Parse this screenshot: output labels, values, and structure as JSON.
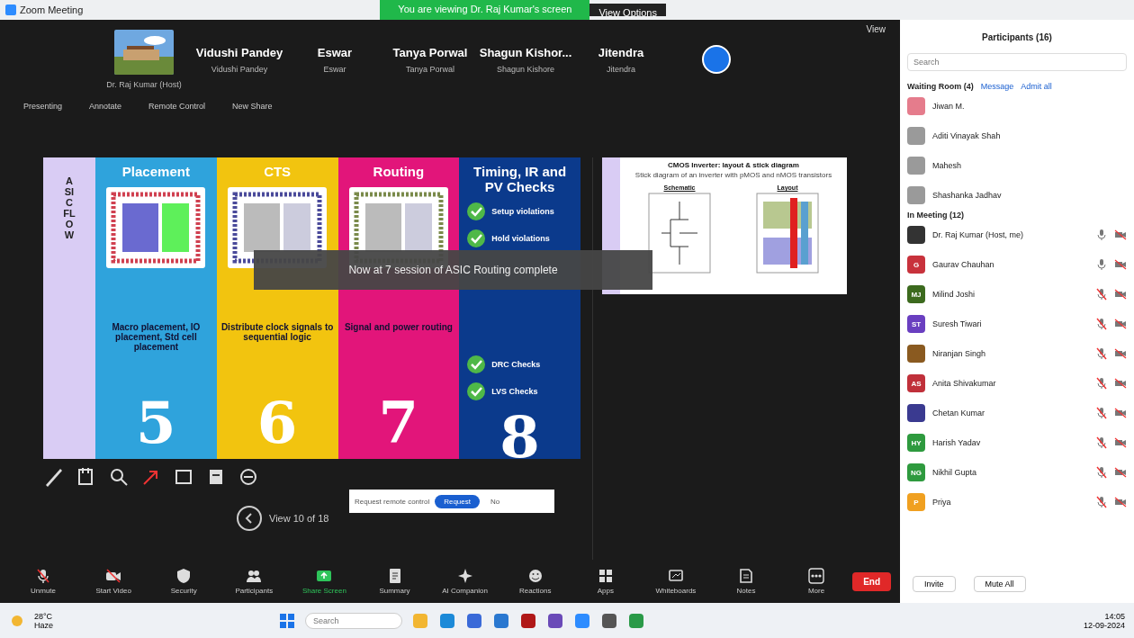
{
  "window": {
    "title": "Zoom Meeting",
    "share_banner": "You are viewing Dr. Raj Kumar's screen",
    "view_options": "View Options"
  },
  "gallery": {
    "tiles": [
      {
        "kind": "picture",
        "caption": "Dr. Raj Kumar (Host)"
      },
      {
        "kind": "name",
        "name": "Vidushi Pandey",
        "caption": "Vidushi Pandey"
      },
      {
        "kind": "name",
        "name": "Eswar",
        "caption": "Eswar"
      },
      {
        "kind": "name",
        "name": "Tanya Porwal",
        "caption": "Tanya Porwal"
      },
      {
        "kind": "name",
        "name": "Shagun Kishor...",
        "caption": "Shagun Kishore"
      },
      {
        "kind": "name",
        "name": "Jitendra",
        "caption": "Jitendra"
      },
      {
        "kind": "avatar"
      }
    ],
    "view": "View"
  },
  "share_bar": {
    "items": [
      "Presenting",
      "Annotate",
      "Remote Control",
      "New Share"
    ]
  },
  "slide_left": {
    "side_title": "ASIC FLOW",
    "columns": [
      {
        "title": "Placement",
        "color": "#2fa3dc",
        "text": "Macro placement, IO placement, Std cell placement",
        "number": "5"
      },
      {
        "title": "CTS",
        "color": "#f2c40f",
        "text": "Distribute clock signals to sequential logic",
        "number": "6"
      },
      {
        "title": "Routing",
        "color": "#e2157a",
        "text": "Signal and power routing",
        "number": "7"
      },
      {
        "title": "Timing, IR and PV Checks",
        "color": "#0b3a8c",
        "checks": [
          "Setup violations",
          "Hold violations",
          "DRC Checks",
          "LVS Checks"
        ],
        "number": "8"
      }
    ]
  },
  "slide_right": {
    "title": "CMOS Inverter: layout & stick diagram",
    "subtitle": "Stick diagram of an inverter with pMOS and nMOS transistors",
    "schematic_label": "Schematic",
    "layout_label": "Layout"
  },
  "toast": "Now at 7 session of ASIC Routing complete",
  "pager": {
    "label": "View 10 of 18"
  },
  "remote_prompt": {
    "text": "Request remote control",
    "button": "Request",
    "dismiss": "No"
  },
  "toolbar": [
    {
      "label": "Unmute",
      "alert": false
    },
    {
      "label": "Start Video",
      "alert": false
    },
    {
      "label": "Security",
      "alert": false
    },
    {
      "label": "Participants",
      "alert": false
    },
    {
      "label": "Share Screen",
      "alert": true
    },
    {
      "label": "Summary",
      "alert": false
    },
    {
      "label": "AI Companion",
      "alert": false
    },
    {
      "label": "Reactions",
      "alert": false
    },
    {
      "label": "Apps",
      "alert": false
    },
    {
      "label": "Whiteboards",
      "alert": false
    },
    {
      "label": "Notes",
      "alert": false
    },
    {
      "label": "More",
      "alert": false
    }
  ],
  "end_button": "End",
  "participants": {
    "title": "Participants (16)",
    "search_placeholder": "Search",
    "waiting_title": "Waiting Room (4)",
    "message": "Message",
    "admit_all": "Admit all",
    "waiting": [
      {
        "name": "Jiwan M.",
        "color": "#e57c8c"
      },
      {
        "name": "Aditi Vinayak Shah",
        "color": "#9a9a9a"
      },
      {
        "name": "Mahesh",
        "color": "#9a9a9a"
      },
      {
        "name": "Shashanka Jadhav",
        "color": "#9a9a9a"
      }
    ],
    "meeting_title": "In Meeting (12)",
    "members": [
      {
        "name": "Dr. Raj Kumar (Host, me)",
        "color": "#333333",
        "muted": false
      },
      {
        "name": "Gaurav Chauhan",
        "initials": "G",
        "color": "#c8323c",
        "muted": false
      },
      {
        "name": "Milind Joshi",
        "initials": "MJ",
        "color": "#3c6a1e",
        "muted": true
      },
      {
        "name": "Suresh Tiwari",
        "initials": "ST",
        "color": "#6a3fc0",
        "muted": true
      },
      {
        "name": "Niranjan Singh",
        "color": "#8a5a20",
        "muted": true
      },
      {
        "name": "Anita Shivakumar",
        "initials": "AS",
        "color": "#c0303a",
        "muted": true
      },
      {
        "name": "Chetan Kumar",
        "color": "#3a3a90",
        "muted": true
      },
      {
        "name": "Harish Yadav",
        "initials": "HY",
        "color": "#2e9a3e",
        "muted": true
      },
      {
        "name": "Nikhil Gupta",
        "initials": "NG",
        "color": "#2e9a3e",
        "muted": true
      },
      {
        "name": "Priya",
        "initials": "P",
        "color": "#f0a020",
        "muted": true
      }
    ],
    "footer": [
      "Invite",
      "Mute All"
    ]
  },
  "taskbar": {
    "weather": "28°C",
    "weather_note": "Haze",
    "search_placeholder": "Search",
    "time": "14:05",
    "date": "12-09-2024"
  }
}
